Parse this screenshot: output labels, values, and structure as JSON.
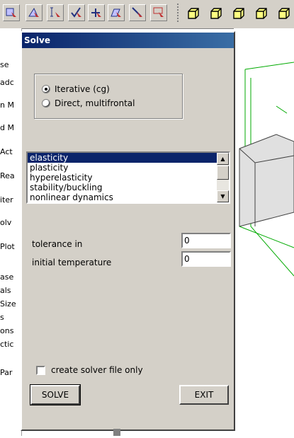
{
  "toolbar": {
    "icons": [
      "select-elements-icon",
      "select-faces-icon",
      "select-edges-icon",
      "select-check-icon",
      "select-cross-icon",
      "select-solid-icon",
      "select-points-icon",
      "select-box-icon"
    ],
    "view_icons": [
      "view-front-icon",
      "view-top-icon",
      "view-side-icon",
      "view-iso-icon",
      "view-back-icon"
    ]
  },
  "left_panel": {
    "items": [
      "se",
      "adc",
      "n M",
      "d M",
      "Act",
      "Rea",
      "iter",
      "olv",
      "Plot",
      "ase",
      "als",
      "Size",
      "s",
      "ons",
      "ctic",
      "Par"
    ]
  },
  "dialog": {
    "title": "Solve",
    "solver_options": [
      {
        "label": "Iterative (cg)",
        "selected": true
      },
      {
        "label": "Direct, multifrontal",
        "selected": false
      }
    ],
    "analysis_types": [
      "elasticity",
      "plasticity",
      "hyperelasticity",
      "stability/buckling",
      "nonlinear dynamics"
    ],
    "selected_analysis": "elasticity",
    "tolerance_label": "tolerance in",
    "tolerance_value": "0",
    "initial_temp_label": "initial temperature",
    "initial_temp_value": "0",
    "create_file_label": "create solver file only",
    "create_file_checked": false,
    "solve_button": "SOLVE",
    "exit_button": "EXIT"
  },
  "colors": {
    "dialog_bg": "#d4d0c8",
    "title_start": "#0a246a",
    "title_end": "#3a6ea5",
    "mesh_line": "#00aa00"
  }
}
